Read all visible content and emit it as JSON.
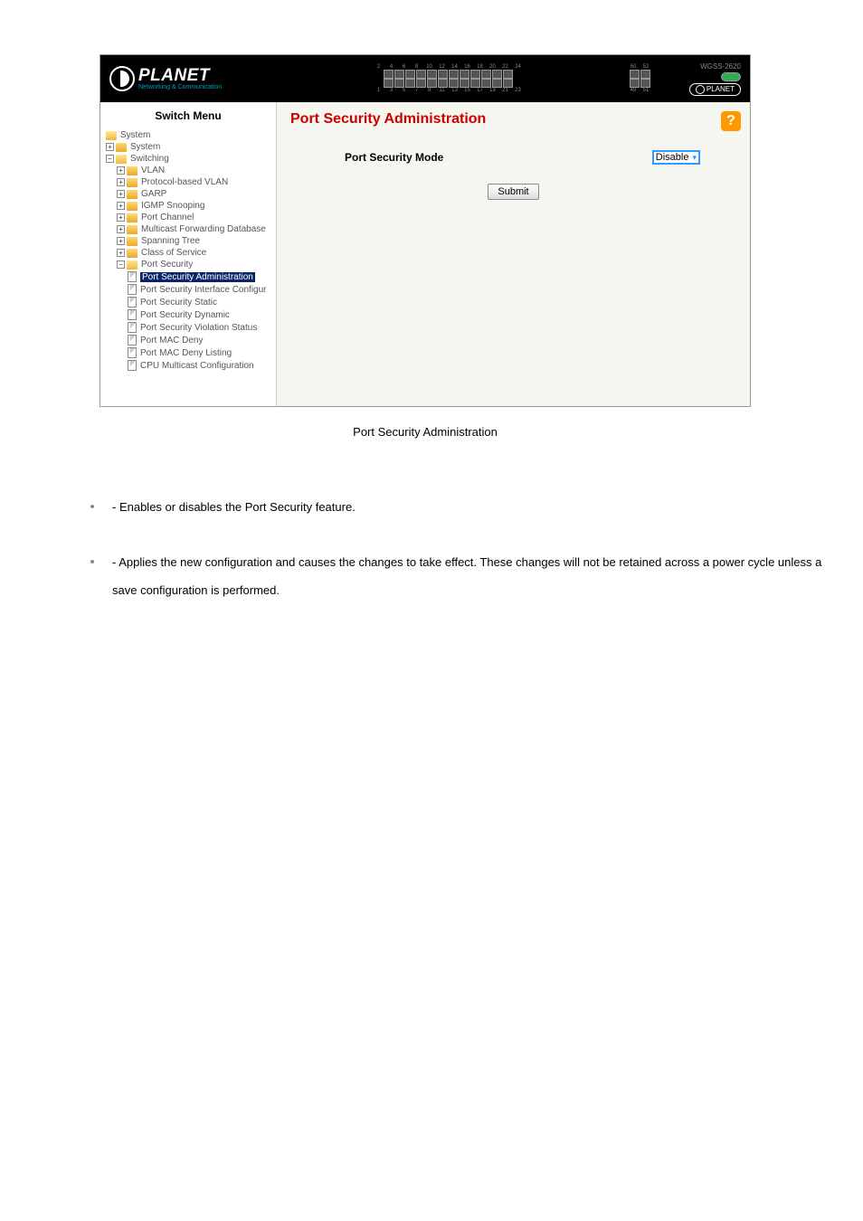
{
  "header": {
    "logo_text": "PLANET",
    "logo_sub": "Networking & Communication",
    "model": "WGSS-2620",
    "planet_label": "PLANET",
    "port_top_nums": [
      "2",
      "4",
      "6",
      "8",
      "10",
      "12",
      "14",
      "16",
      "18",
      "20",
      "22",
      "24"
    ],
    "port_bot_nums": [
      "1",
      "3",
      "5",
      "7",
      "9",
      "11",
      "13",
      "15",
      "17",
      "19",
      "21",
      "23"
    ],
    "port_r_top": [
      "50",
      "52"
    ],
    "port_r_bot": [
      "49",
      "51"
    ]
  },
  "sidebar": {
    "title": "Switch Menu",
    "items": {
      "system_root": "System",
      "system": "System",
      "switching": "Switching",
      "vlan": "VLAN",
      "protocol_vlan": "Protocol-based VLAN",
      "garp": "GARP",
      "igmp": "IGMP Snooping",
      "port_channel": "Port Channel",
      "mcast_fwd": "Multicast Forwarding Database",
      "spanning": "Spanning Tree",
      "cos": "Class of Service",
      "port_security": "Port Security",
      "ps_admin": "Port Security Administration",
      "ps_iface": "Port Security Interface Configur",
      "ps_static": "Port Security Static",
      "ps_dynamic": "Port Security Dynamic",
      "ps_violation": "Port Security Violation Status",
      "ps_mac_deny": "Port MAC Deny",
      "ps_mac_deny_list": "Port MAC Deny Listing",
      "cpu_mcast": "CPU Multicast Configuration"
    }
  },
  "main": {
    "title": "Port Security Administration",
    "mode_label": "Port Security Mode",
    "mode_value": "Disable",
    "submit_label": "Submit",
    "help_label": "?"
  },
  "caption": "Port Security Administration",
  "doc": {
    "item1": " - Enables or disables the Port Security feature.",
    "item2": " - Applies the new configuration and causes the changes to take effect. These changes will not be retained across a power cycle unless a save configuration is performed."
  }
}
